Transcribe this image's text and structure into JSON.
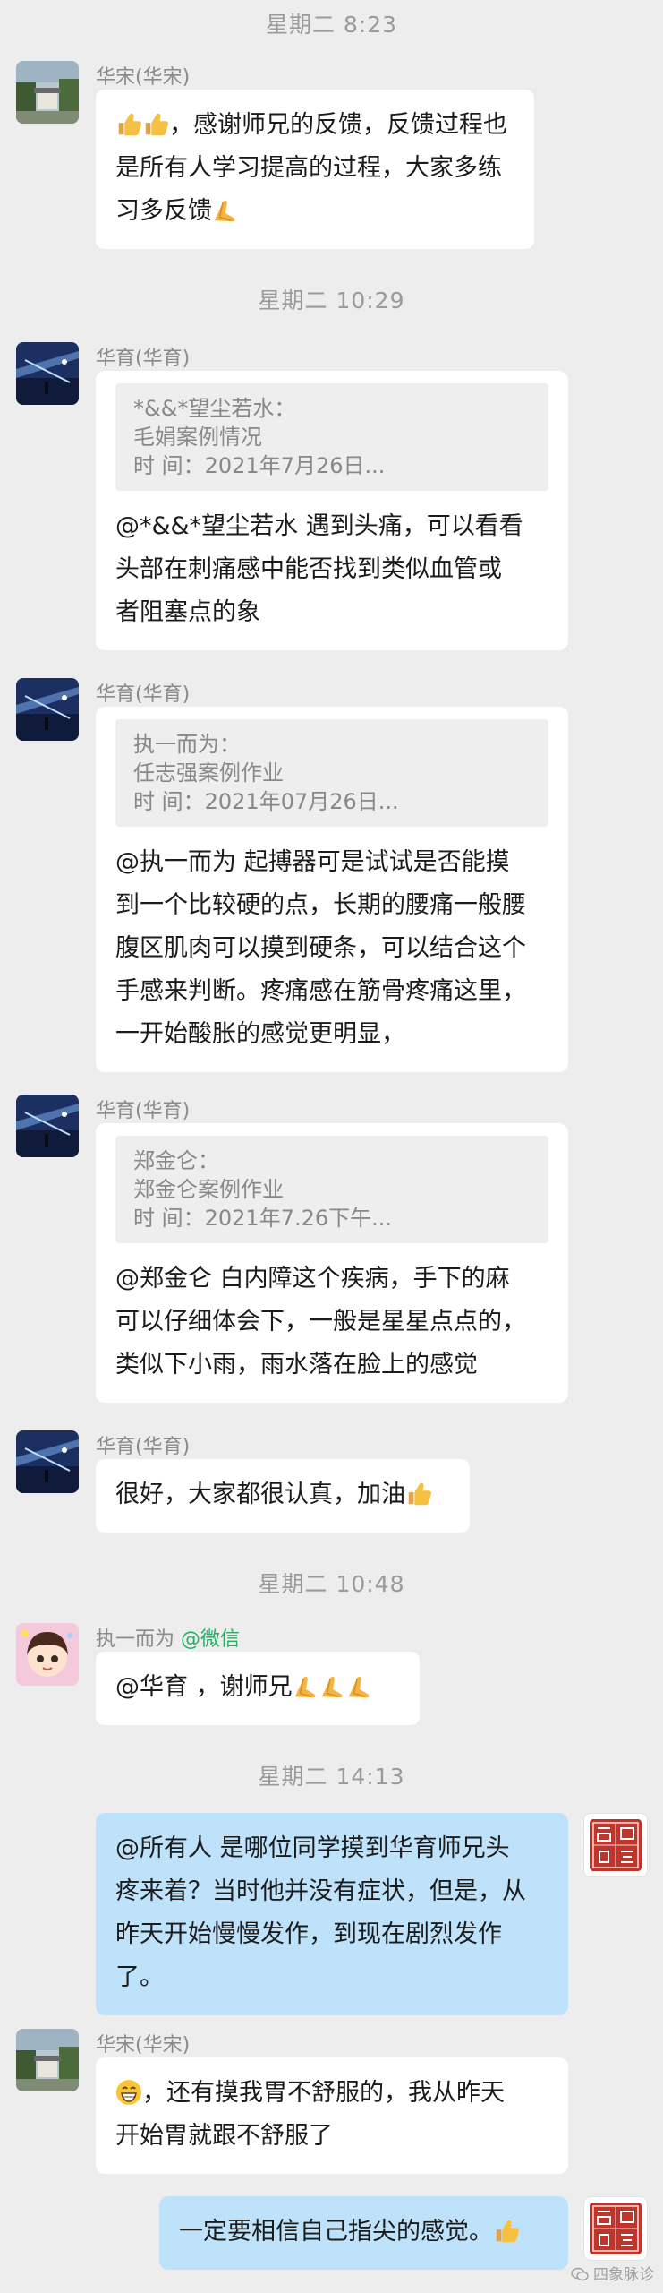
{
  "timestamps": {
    "t1": "星期二  8:23",
    "t2": "星期二  10:29",
    "t3": "星期二  10:48",
    "t4": "星期二  14:13"
  },
  "messages": {
    "m1": {
      "sender": "华宋(华宋)",
      "text": "，感谢师兄的反馈，反馈过程也\n是所有人学习提高的过程，大家多练\n习多反馈"
    },
    "m2": {
      "sender": "华育(华育)",
      "quote": {
        "author": "*&&*望尘若水：",
        "title": "毛娟案例情况",
        "time": "时  间：2021年7月26日..."
      },
      "text": "@*&&*望尘若水 遇到头痛，可以看看\n头部在刺痛感中能否找到类似血管或\n者阻塞点的象"
    },
    "m3": {
      "sender": "华育(华育)",
      "quote": {
        "author": "执一而为：",
        "title": "任志强案例作业",
        "time": "时  间：2021年07月26日..."
      },
      "text": "@执一而为 起搏器可是试试是否能摸\n到一个比较硬的点，长期的腰痛一般腰\n腹区肌肉可以摸到硬条，可以结合这个\n手感来判断。疼痛感在筋骨疼痛这里，\n一开始酸胀的感觉更明显，"
    },
    "m4": {
      "sender": "华育(华育)",
      "quote": {
        "author": "郑金仑：",
        "title": "郑金仑案例作业",
        "time": "时  间：2021年7.26下午..."
      },
      "text": "@郑金仑 白内障这个疾病，手下的麻\n可以仔细体会下，一般是星星点点的，\n类似下小雨，雨水落在脸上的感觉"
    },
    "m5": {
      "sender": "华育(华育)",
      "text": "很好，大家都很认真，加油"
    },
    "m6": {
      "sender": "执一而为",
      "sender_suffix": "@微信",
      "text": "@华育 ，谢师兄"
    },
    "m7": {
      "text": "@所有人 是哪位同学摸到华育师兄头\n疼来着？当时他并没有症状，但是，从\n昨天开始慢慢发作，到现在剧烈发作\n了。"
    },
    "m8": {
      "sender": "华宋(华宋)",
      "text": "，还有摸我胃不舒服的，我从昨天\n开始胃就跟不舒服了"
    },
    "m9": {
      "text": "一定要相信自己指尖的感觉。"
    }
  },
  "logo": {
    "chars": "醫 道 聖 醫"
  },
  "watermark": "四象脉诊",
  "colors": {
    "bubble_self": "#bfe2fb",
    "bubble_other": "#ffffff",
    "background": "#ededed",
    "logo_red": "#c0352b"
  }
}
